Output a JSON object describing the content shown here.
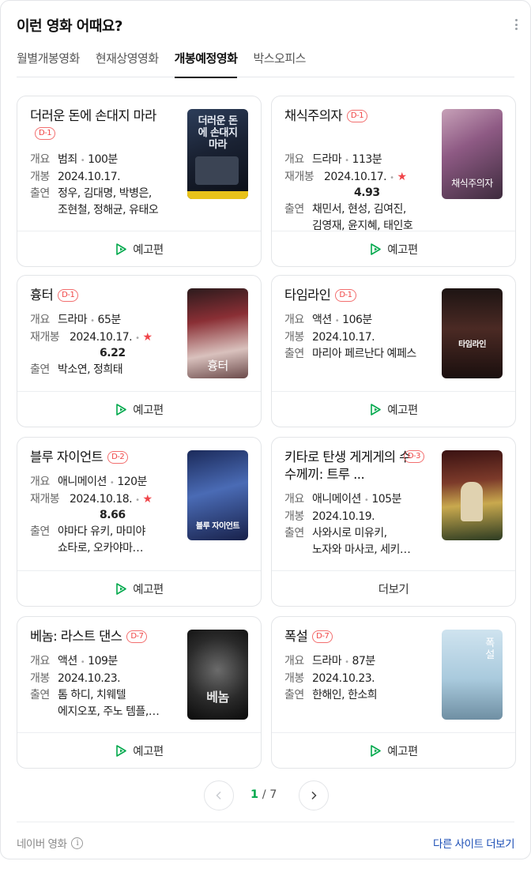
{
  "header": {
    "title": "이런 영화 어때요?"
  },
  "tabs": [
    "월별개봉영화",
    "현재상영영화",
    "개봉예정영화",
    "박스오피스"
  ],
  "movies": [
    {
      "title": "더러운 돈에 손대지 마라",
      "badge": "D-1",
      "summary_label": "개요",
      "genre": "범죄",
      "runtime": "100분",
      "release_label": "개봉",
      "release": "2024.10.17.",
      "rating": "",
      "cast_label": "출연",
      "cast1": "정우, 김대명, 박병은,",
      "cast2": "조현철, 정해균, 유태오",
      "footer": "예고편",
      "poster_text": "더러운 돈에 손대지 마라"
    },
    {
      "title": "채식주의자",
      "badge": "D-1",
      "summary_label": "개요",
      "genre": "드라마",
      "runtime": "113분",
      "release_label": "재개봉",
      "release": "2024.10.17.",
      "rating": "4.93",
      "cast_label": "출연",
      "cast1": "채민서, 현성, 김여진,",
      "cast2": "김영재, 윤지혜, 태인호",
      "footer": "예고편",
      "poster_text": "채식주의자"
    },
    {
      "title": "흉터",
      "badge": "D-1",
      "summary_label": "개요",
      "genre": "드라마",
      "runtime": "65분",
      "release_label": "재개봉",
      "release": "2024.10.17.",
      "rating": "6.22",
      "cast_label": "출연",
      "cast1": "박소연, 정희태",
      "cast2": "",
      "footer": "예고편",
      "poster_text": "흉터"
    },
    {
      "title": "타임라인",
      "badge": "D-1",
      "summary_label": "개요",
      "genre": "액션",
      "runtime": "106분",
      "release_label": "개봉",
      "release": "2024.10.17.",
      "rating": "",
      "cast_label": "출연",
      "cast1": "마리아 페르난다 예페스",
      "cast2": "",
      "footer": "예고편",
      "poster_text": "타임라인"
    },
    {
      "title": "블루 자이언트",
      "badge": "D-2",
      "summary_label": "개요",
      "genre": "애니메이션",
      "runtime": "120분",
      "release_label": "재개봉",
      "release": "2024.10.18.",
      "rating": "8.66",
      "cast_label": "출연",
      "cast1": "야마다 유키, 마미야",
      "cast2": "쇼타로, 오카야마…",
      "footer": "예고편",
      "poster_text": "블루 자이언트"
    },
    {
      "title": "키타로 탄생 게게게의 수수께끼: 트루 ...",
      "badge": "D-3",
      "summary_label": "개요",
      "genre": "애니메이션",
      "runtime": "105분",
      "release_label": "개봉",
      "release": "2024.10.19.",
      "rating": "",
      "cast_label": "출연",
      "cast1": "사와시로 미유키,",
      "cast2": "노자와 마사코, 세키…",
      "footer": "더보기",
      "poster_text": ""
    },
    {
      "title": "베놈: 라스트 댄스",
      "badge": "D-7",
      "summary_label": "개요",
      "genre": "액션",
      "runtime": "109분",
      "release_label": "개봉",
      "release": "2024.10.23.",
      "rating": "",
      "cast_label": "출연",
      "cast1": "톰 하디, 치웨텔",
      "cast2": "에지오포, 주노 템플,…",
      "footer": "예고편",
      "poster_text": "베놈"
    },
    {
      "title": "폭설",
      "badge": "D-7",
      "summary_label": "개요",
      "genre": "드라마",
      "runtime": "87분",
      "release_label": "개봉",
      "release": "2024.10.23.",
      "rating": "",
      "cast_label": "출연",
      "cast1": "한해인, 한소희",
      "cast2": "",
      "footer": "예고편",
      "poster_text": "폭설"
    }
  ],
  "pager": {
    "current": "1",
    "separator": "/",
    "total": "7"
  },
  "footer": {
    "source": "네이버 영화",
    "info_glyph": "i",
    "more": "다른 사이트 더보기"
  },
  "colors": {
    "accent": "#03a94d",
    "badge": "#f04545",
    "link": "#1a4db5"
  }
}
